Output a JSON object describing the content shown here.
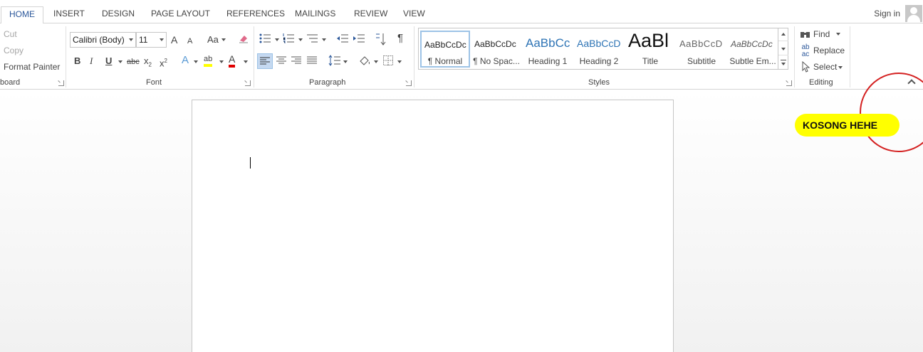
{
  "tabs": [
    "HOME",
    "INSERT",
    "DESIGN",
    "PAGE LAYOUT",
    "REFERENCES",
    "MAILINGS",
    "REVIEW",
    "VIEW"
  ],
  "signin": "Sign in",
  "clipboard": {
    "cut": "Cut",
    "copy": "Copy",
    "format_painter": "Format Painter",
    "label": "board"
  },
  "font": {
    "name": "Calibri (Body)",
    "size": "11",
    "grow": "A",
    "shrink": "A",
    "change_case": "Aa",
    "bold": "B",
    "italic": "I",
    "underline": "U",
    "strike": "abc",
    "subscript": "x",
    "superscript": "x",
    "text_effects": "A",
    "highlight": "ab",
    "font_color": "A",
    "label": "Font"
  },
  "paragraph": {
    "pilcrow": "¶",
    "label": "Paragraph"
  },
  "styles": {
    "items": [
      {
        "preview": "AaBbCcDc",
        "name": "¶ Normal"
      },
      {
        "preview": "AaBbCcDc",
        "name": "¶ No Spac..."
      },
      {
        "preview": "AaBbCc",
        "name": "Heading 1"
      },
      {
        "preview": "AaBbCcD",
        "name": "Heading 2"
      },
      {
        "preview": "AaBl",
        "name": "Title"
      },
      {
        "preview": "AaBbCcD",
        "name": "Subtitle"
      },
      {
        "preview": "AaBbCcDc",
        "name": "Subtle Em..."
      }
    ],
    "label": "Styles"
  },
  "editing": {
    "find": "Find",
    "replace": "Replace",
    "select": "Select",
    "label": "Editing"
  },
  "annotation": {
    "text": "KOSONG HEHE"
  },
  "colors": {
    "accent": "#2b579a",
    "highlight": "#ffff00",
    "font_red": "#e00000",
    "annotation_circle": "#d42020"
  }
}
